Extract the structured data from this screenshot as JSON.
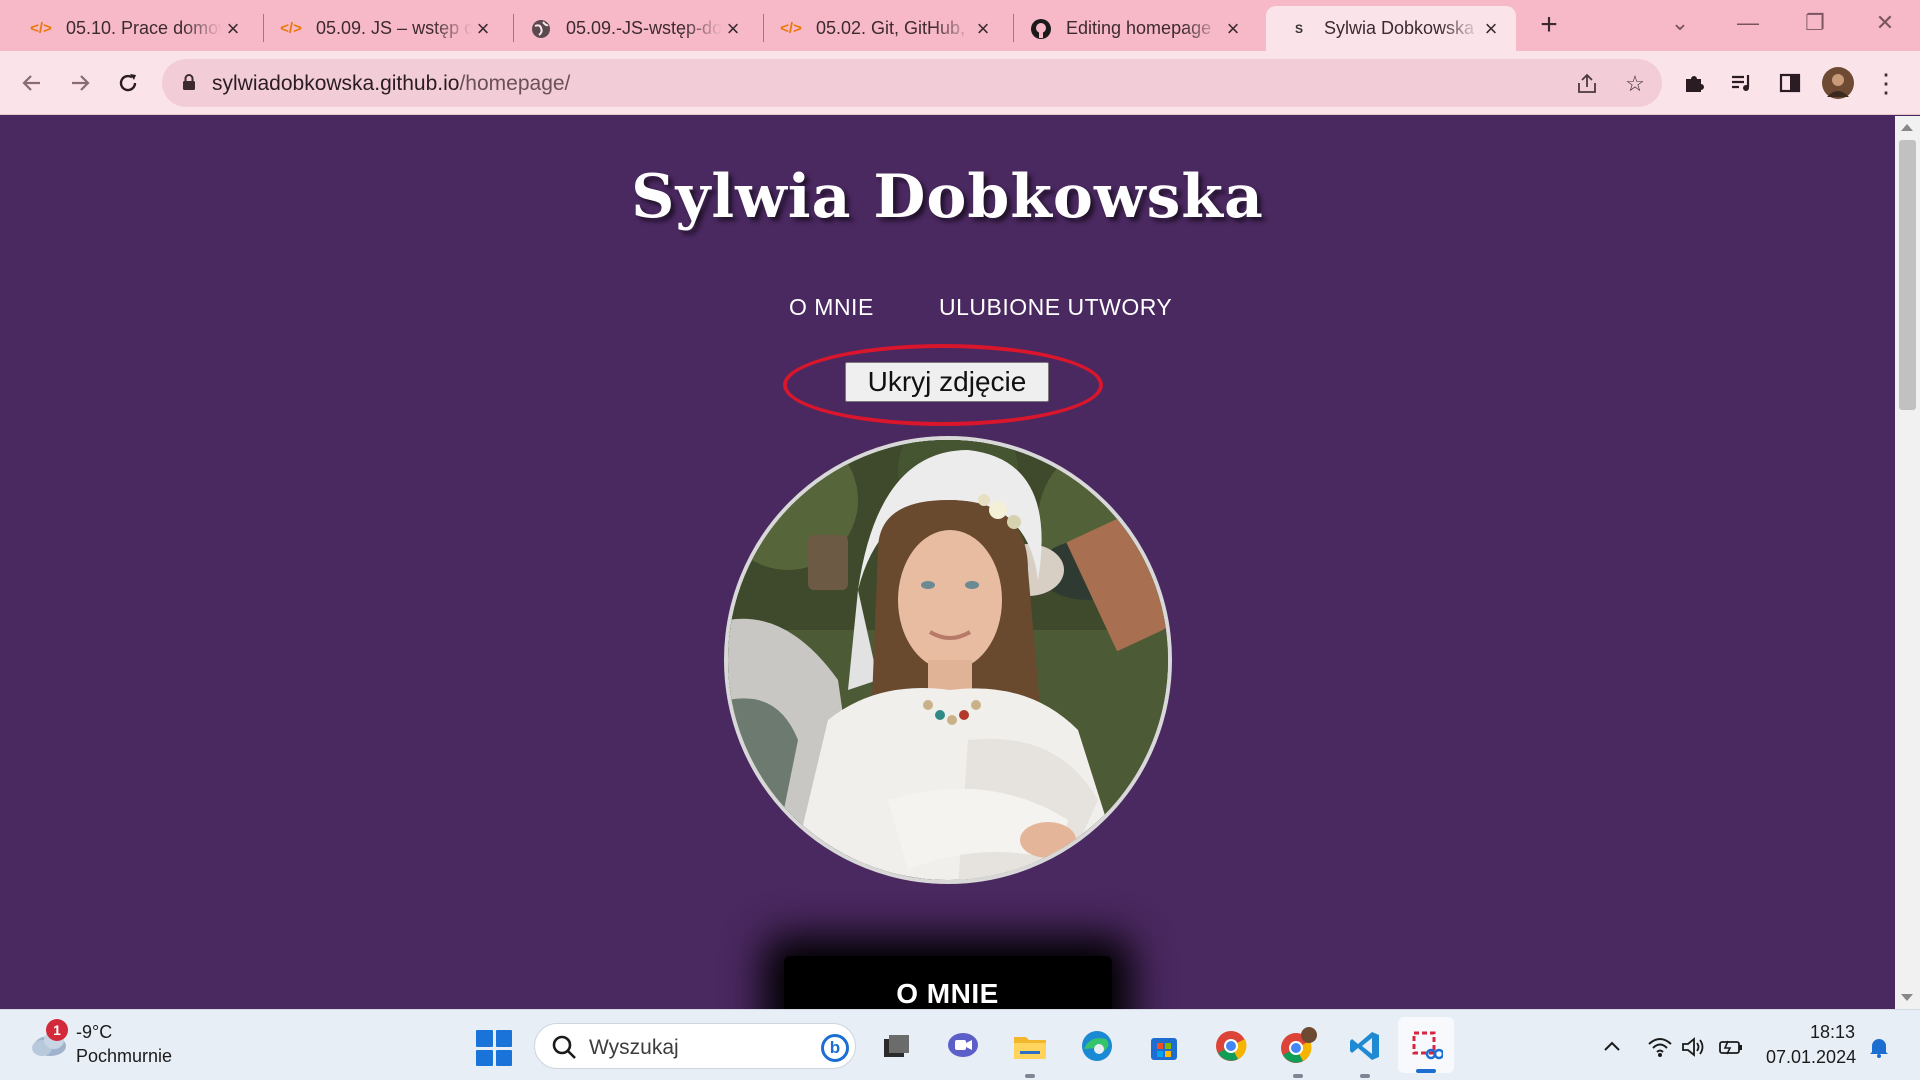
{
  "browser": {
    "tabs": [
      {
        "title": "05.10. Prace domowe",
        "favicon": "code-icon",
        "active": false
      },
      {
        "title": "05.09. JS – wstęp do",
        "favicon": "code-icon",
        "active": false
      },
      {
        "title": "05.09.-JS-wstęp-do",
        "favicon": "globe-icon",
        "active": false
      },
      {
        "title": "05.02. Git, GitHub,",
        "favicon": "code-icon",
        "active": false
      },
      {
        "title": "Editing homepage",
        "favicon": "github-icon",
        "active": false
      },
      {
        "title": "Sylwia Dobkowska",
        "favicon": "site-icon",
        "active": true
      }
    ],
    "url_domain": "sylwiadobkowska.github.io",
    "url_path": "/homepage/"
  },
  "page": {
    "title": "Sylwia Dobkowska",
    "nav": [
      "O MNIE",
      "ULUBIONE UTWORY"
    ],
    "hide_button_label": "Ukryj zdjęcie",
    "section_title": "O MNIE",
    "background_color": "#4a2860"
  },
  "taskbar": {
    "weather_badge": "1",
    "weather_temp": "-9°C",
    "weather_desc": "Pochmurnie",
    "search_placeholder": "Wyszukaj",
    "time": "18:13",
    "date": "07.01.2024"
  }
}
